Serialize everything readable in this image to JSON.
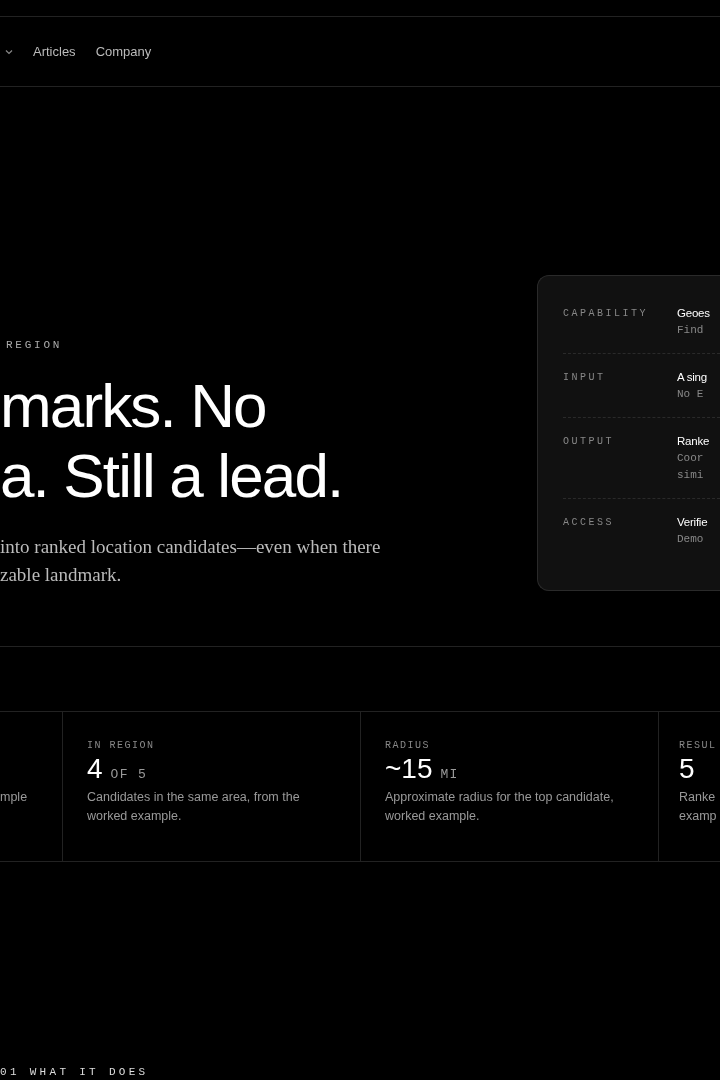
{
  "nav": {
    "items": [
      {
        "label": "Articles"
      },
      {
        "label": "Company"
      }
    ]
  },
  "hero": {
    "eyebrow": "REGION",
    "headline_lines": [
      "marks. No",
      "a. Still a lead."
    ],
    "subtitle_lines": [
      "into ranked location candidates—even when there",
      "zable landmark."
    ]
  },
  "spec_card": {
    "rows": [
      {
        "label": "CAPABILITY",
        "value": "Geoes",
        "detail_lines": [
          "Find"
        ]
      },
      {
        "label": "INPUT",
        "value": "A sing",
        "detail_lines": [
          "No E"
        ]
      },
      {
        "label": "OUTPUT",
        "value": "Ranke",
        "detail_lines": [
          "Coor",
          "simi"
        ]
      },
      {
        "label": "ACCESS",
        "value": "Verifie",
        "detail_lines": [
          "Demo"
        ]
      }
    ]
  },
  "stats": [
    {
      "description_lines": [
        "mple"
      ]
    },
    {
      "label": "IN REGION",
      "value": "4",
      "unit": "OF 5",
      "description_lines": [
        "Candidates in the same area, from the",
        "worked example."
      ]
    },
    {
      "label": "RADIUS",
      "value": "~15",
      "unit": "MI",
      "description_lines": [
        "Approximate radius for the top candidate,",
        "worked example."
      ]
    },
    {
      "label": "RESUL",
      "value": "5",
      "description_lines": [
        "Ranke",
        "examp"
      ]
    }
  ],
  "section_label": "01 WHAT IT DOES"
}
